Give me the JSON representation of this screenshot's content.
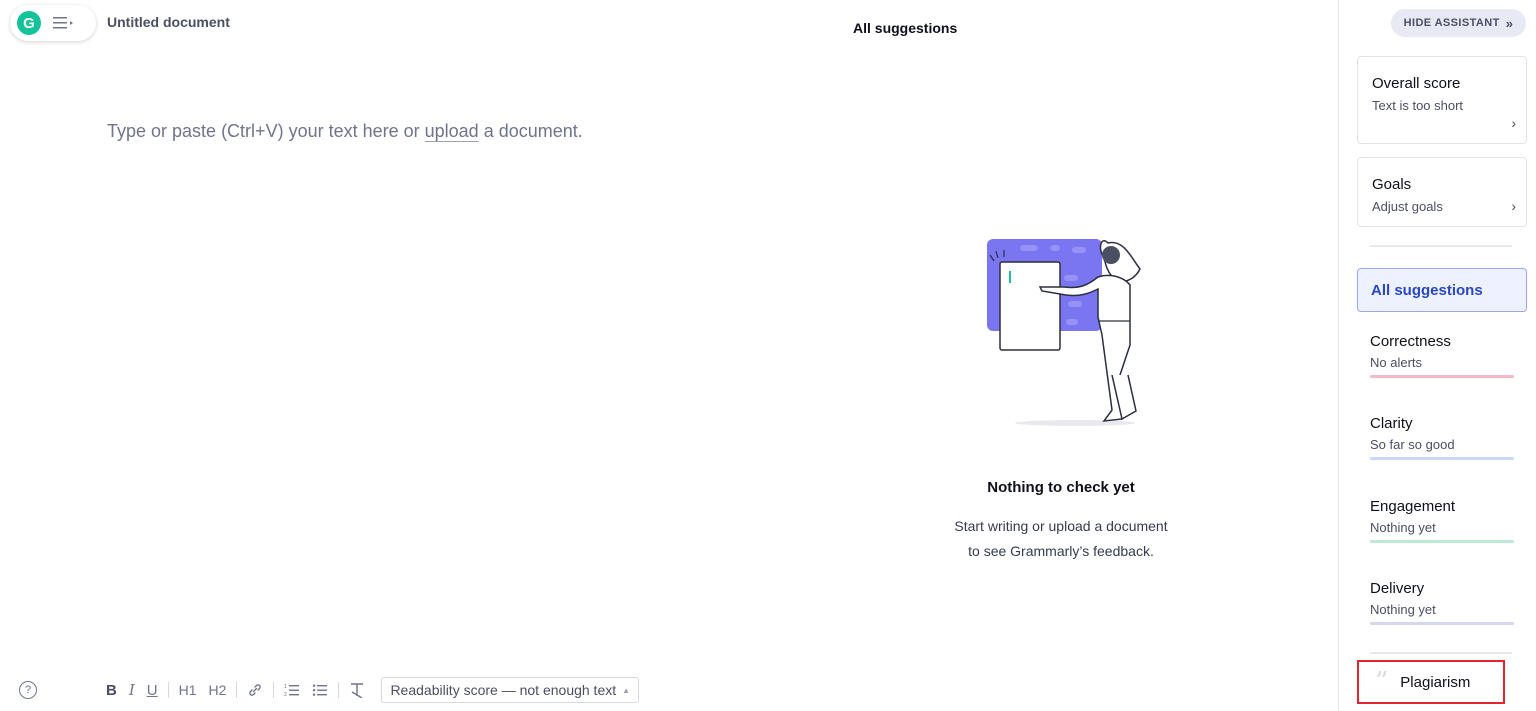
{
  "header": {
    "logo_letter": "G",
    "document_title": "Untitled document",
    "panel_title": "All suggestions"
  },
  "editor": {
    "placeholder_before": "Type or paste (Ctrl+V) your text here or ",
    "upload_link": "upload",
    "placeholder_after": " a document."
  },
  "empty_state": {
    "title": "Nothing to check yet",
    "line1": "Start writing or upload a document",
    "line2": "to see Grammarly’s feedback."
  },
  "toolbar": {
    "help": "?",
    "bold": "B",
    "italic": "I",
    "underline": "U",
    "h1": "H1",
    "h2": "H2",
    "readability": "Readability score — not enough text"
  },
  "sidebar": {
    "hide_assistant": "HIDE ASSISTANT",
    "overall": {
      "title": "Overall score",
      "subtitle": "Text is too short"
    },
    "goals": {
      "title": "Goals",
      "subtitle": "Adjust goals"
    },
    "all_suggestions": "All suggestions",
    "categories": [
      {
        "title": "Correctness",
        "subtitle": "No alerts",
        "color": "#f5b8c4"
      },
      {
        "title": "Clarity",
        "subtitle": "So far so good",
        "color": "#c9d6f7"
      },
      {
        "title": "Engagement",
        "subtitle": "Nothing yet",
        "color": "#bfe9d7"
      },
      {
        "title": "Delivery",
        "subtitle": "Nothing yet",
        "color": "#d4d6f2"
      }
    ],
    "plagiarism": "Plagiarism"
  },
  "colors": {
    "brand": "#15c39a",
    "accent": "#2a47c6",
    "illustration_purple": "#7a75f0",
    "highlight_red": "#e3252b"
  },
  "icons": {
    "logo": "grammarly-logo-icon",
    "menu": "hamburger-menu-icon",
    "help": "question-circle-icon",
    "link": "link-icon",
    "ordered_list": "ordered-list-icon",
    "bullet_list": "bullet-list-icon",
    "clear_format": "clear-format-icon",
    "plagiarism": "quote-icon"
  }
}
